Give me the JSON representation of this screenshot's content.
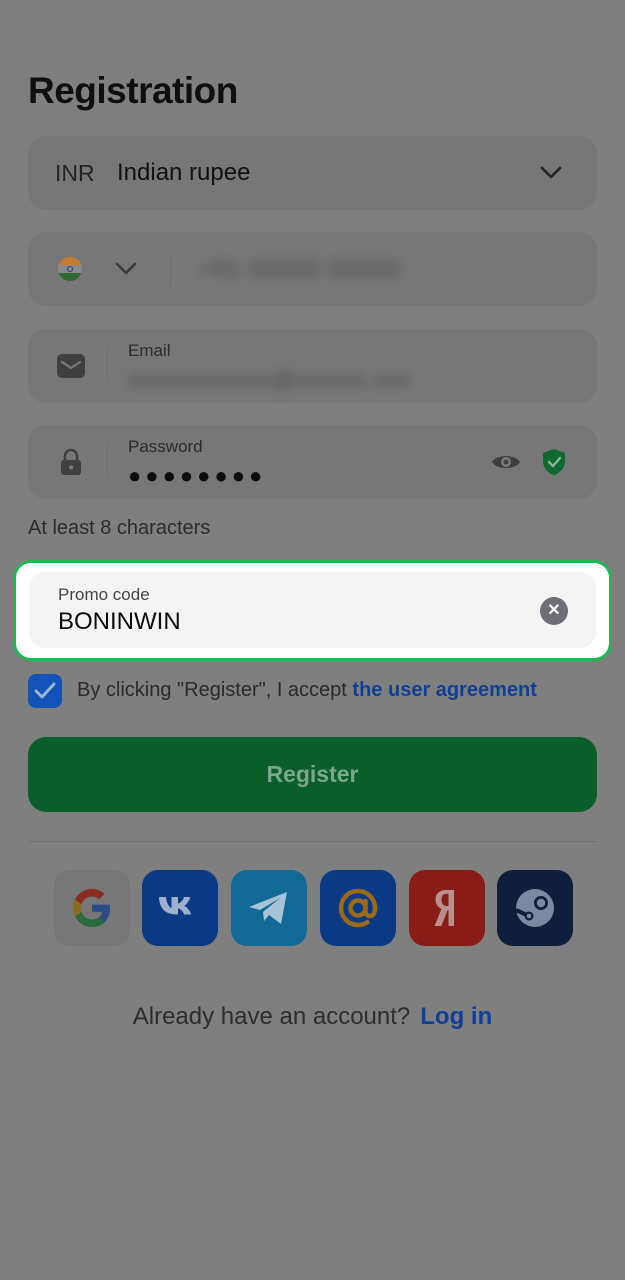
{
  "page": {
    "title": "Registration"
  },
  "currency": {
    "code": "INR",
    "name": "Indian rupee",
    "icon": "chevron-down-icon"
  },
  "phone": {
    "flag_icon": "india-flag-icon",
    "dropdown_icon": "chevron-down-icon",
    "value_obscured": "+91 00000 00000"
  },
  "email": {
    "label": "Email",
    "value_obscured": "xxxxxxxxxxxx@xxxxxx.xxx",
    "icon": "envelope-icon"
  },
  "password": {
    "label": "Password",
    "value": "●●●●●●●●",
    "hint": "At least 8 characters",
    "icon": "lock-icon",
    "toggle_icon": "eye-icon",
    "strength_icon": "shield-check-icon"
  },
  "promo": {
    "label": "Promo code",
    "value": "BONINWIN",
    "clear_symbol": "✕",
    "highlight_color": "#1db954"
  },
  "agreement": {
    "checked": true,
    "text": "By clicking \"Register\", I accept",
    "link_text": "the user agreement"
  },
  "register": {
    "label": "Register"
  },
  "social": {
    "providers": [
      "google",
      "vk",
      "telegram",
      "mail",
      "yandex",
      "steam"
    ]
  },
  "footer": {
    "question": "Already have an account?",
    "login_link": "Log in"
  },
  "colors": {
    "overlay_bg": "#7f7f7f",
    "accent_green": "#0a5e2a",
    "link_blue": "#0f3f97"
  }
}
